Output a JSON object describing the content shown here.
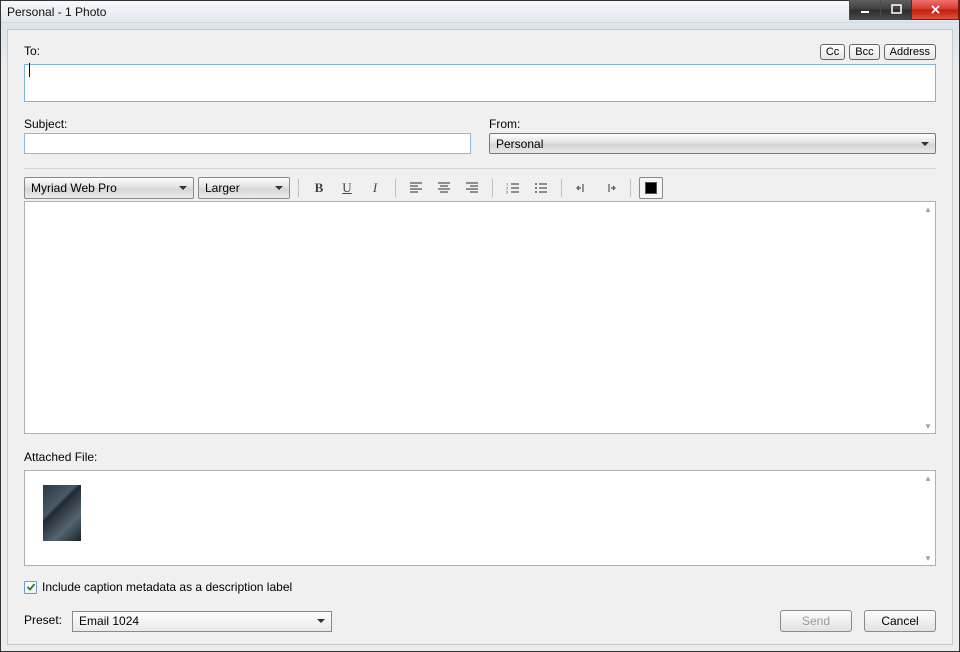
{
  "titlebar": {
    "title": "Personal - 1 Photo"
  },
  "labels": {
    "to": "To:",
    "subject": "Subject:",
    "from": "From:",
    "attached": "Attached File:",
    "preset": "Preset:"
  },
  "buttons": {
    "cc": "Cc",
    "bcc": "Bcc",
    "address": "Address",
    "send": "Send",
    "cancel": "Cancel"
  },
  "fields": {
    "to_value": "",
    "subject_value": "",
    "from_selected": "Personal",
    "body_value": ""
  },
  "toolbar": {
    "font": "Myriad Web Pro",
    "size": "Larger",
    "bold": "B",
    "underline": "U",
    "italic": "I"
  },
  "checkbox": {
    "checked": true,
    "label": "Include caption metadata as a description label"
  },
  "preset": {
    "selected": "Email 1024"
  }
}
